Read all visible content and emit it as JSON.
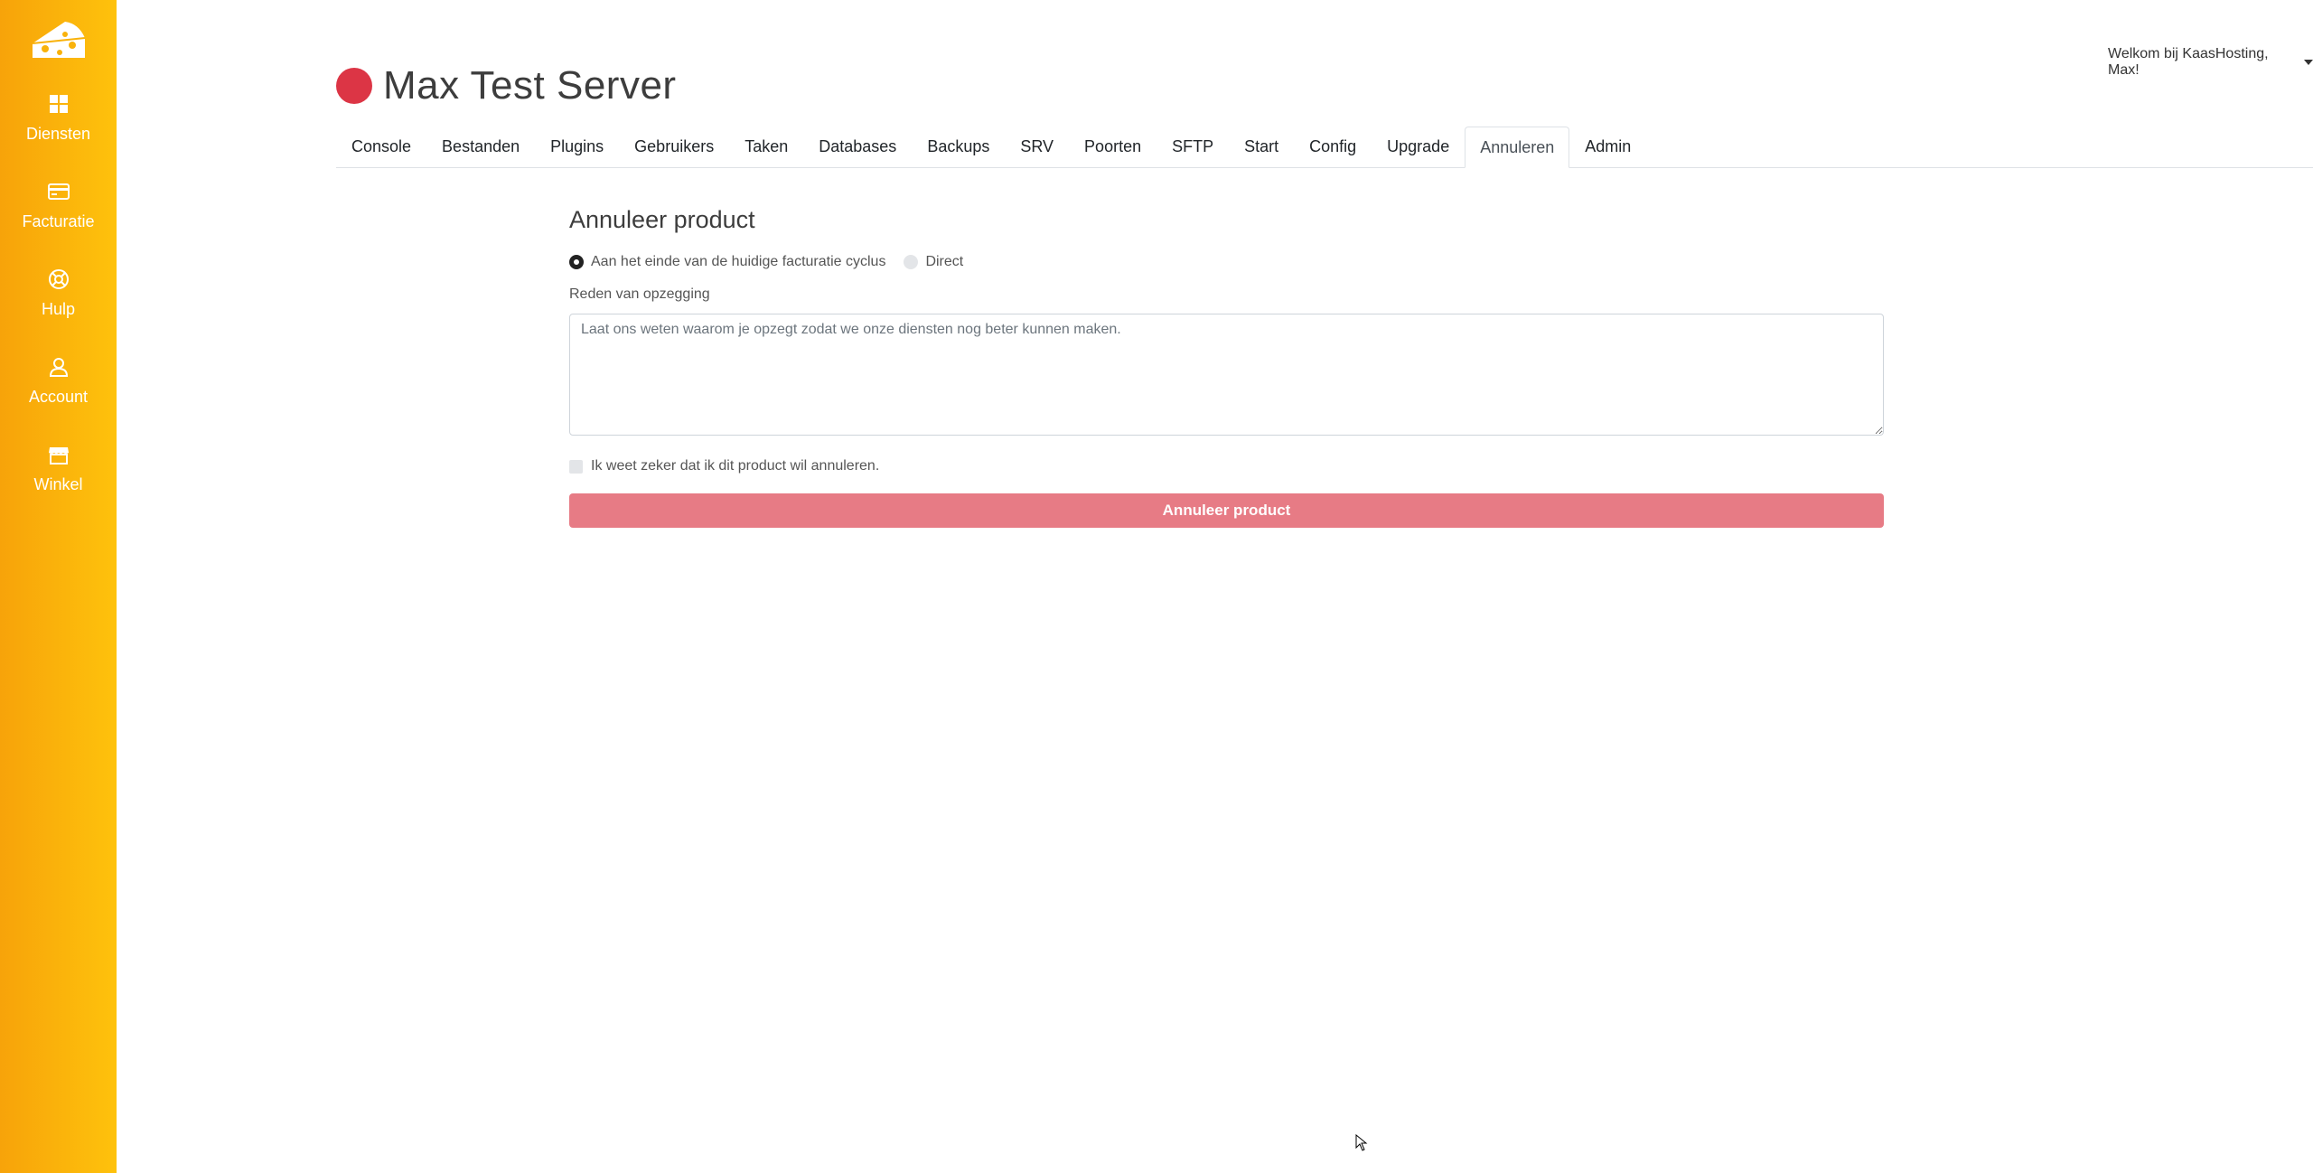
{
  "sidebar": {
    "logo_icon": "cheese-logo-icon",
    "items": [
      {
        "label": "Diensten",
        "icon": "grid-icon"
      },
      {
        "label": "Facturatie",
        "icon": "credit-card-icon"
      },
      {
        "label": "Hulp",
        "icon": "lifebuoy-icon"
      },
      {
        "label": "Account",
        "icon": "user-icon"
      },
      {
        "label": "Winkel",
        "icon": "store-icon"
      }
    ],
    "colors": {
      "gradient_start": "#f7a30a",
      "gradient_end": "#fec20c"
    }
  },
  "header": {
    "user_menu": "Welkom bij KaasHosting, Max!",
    "title": "Max Test Server",
    "status_color": "#dc3545"
  },
  "tabs": [
    {
      "label": "Console"
    },
    {
      "label": "Bestanden"
    },
    {
      "label": "Plugins"
    },
    {
      "label": "Gebruikers"
    },
    {
      "label": "Taken"
    },
    {
      "label": "Databases"
    },
    {
      "label": "Backups"
    },
    {
      "label": "SRV"
    },
    {
      "label": "Poorten"
    },
    {
      "label": "SFTP"
    },
    {
      "label": "Start"
    },
    {
      "label": "Config"
    },
    {
      "label": "Upgrade"
    },
    {
      "label": "Annuleren",
      "active": true
    },
    {
      "label": "Admin"
    }
  ],
  "cancel_form": {
    "title": "Annuleer product",
    "option_end_of_cycle": "Aan het einde van de huidige facturatie cyclus",
    "option_direct": "Direct",
    "selected_option": "Aan het einde van de huidige facturatie cyclus",
    "reason_label": "Reden van opzegging",
    "reason_placeholder": "Laat ons weten waarom je opzegt zodat we onze diensten nog beter kunnen maken.",
    "reason_value": "",
    "confirm_label": "Ik weet zeker dat ik dit product wil annuleren.",
    "confirm_checked": false,
    "submit_label": "Annuleer product",
    "submit_color": "#e77b85"
  }
}
